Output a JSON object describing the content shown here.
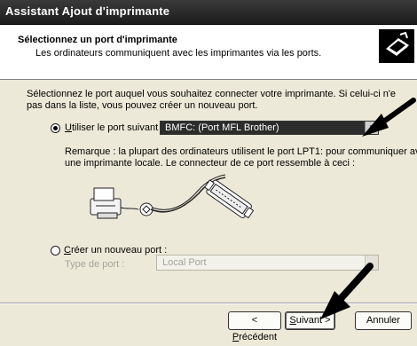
{
  "window": {
    "title": "Assistant Ajout d'imprimante"
  },
  "header": {
    "title": "Sélectionnez un port d'imprimante",
    "subtitle": "Les ordinateurs communiquent avec les imprimantes via les ports."
  },
  "intro": {
    "line1": "Sélectionnez le port auquel vous souhaitez connecter votre imprimante. Si celui-ci n'e",
    "line2": "pas dans la liste, vous pouvez créer un nouveau port."
  },
  "option_existing": {
    "label_key": "U",
    "label_rest": "tiliser le port suivant :",
    "selected": true,
    "value": "BMFC: (Port MFL Brother)"
  },
  "remark": {
    "line1": "Remarque : la plupart des ordinateurs utilisent le port LPT1: pour communiquer avec",
    "line2": "une imprimante locale. Le connecteur de ce port ressemble à ceci :"
  },
  "option_new": {
    "label_key": "C",
    "label_rest": "réer un nouveau port :",
    "selected": false,
    "type_label": "Type de port :",
    "type_value": "Local Port"
  },
  "buttons": {
    "back_open": "< ",
    "back_key": "P",
    "back_rest": "récédent",
    "next_key": "S",
    "next_rest": "uivant >",
    "cancel": "Annuler"
  },
  "colors": {
    "titlebar": "#1c1c1c",
    "dialog_bg": "#ece9d8",
    "selection_bg": "#2c2c2c"
  },
  "icons": [
    "printer-wizard-icon",
    "chevron-down-icon",
    "parallel-cable-illustration",
    "callout-arrow"
  ]
}
